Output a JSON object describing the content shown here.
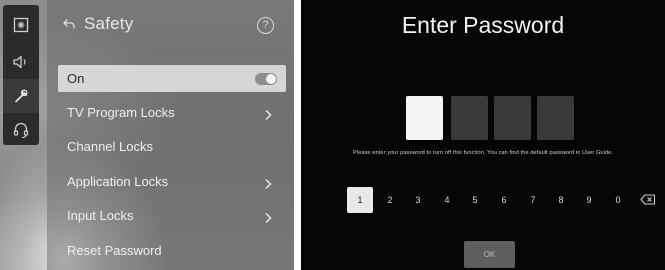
{
  "settings": {
    "header": {
      "title": "Safety",
      "help_symbol": "?"
    },
    "toggle_row": {
      "label": "On",
      "state": "on"
    },
    "menu": [
      {
        "label": "TV Program Locks",
        "has_chevron": true
      },
      {
        "label": "Channel Locks",
        "has_chevron": false
      },
      {
        "label": "Application Locks",
        "has_chevron": true
      },
      {
        "label": "Input Locks",
        "has_chevron": true
      },
      {
        "label": "Reset Password",
        "has_chevron": false
      }
    ],
    "rail_icons": [
      "picture-icon",
      "sound-icon",
      "general-icon",
      "support-icon"
    ]
  },
  "password": {
    "title": "Enter Password",
    "hint": "Please enter your password to turn off this function. You can find the default password in User Guide.",
    "keys": [
      "1",
      "2",
      "3",
      "4",
      "5",
      "6",
      "7",
      "8",
      "9",
      "0"
    ],
    "selected_key": "1",
    "ok_label": "OK"
  },
  "colors": {
    "left_background": "#828282",
    "right_background": "#050505",
    "active_box": "#f3f3f3",
    "inactive_box": "#3a3a3a"
  }
}
